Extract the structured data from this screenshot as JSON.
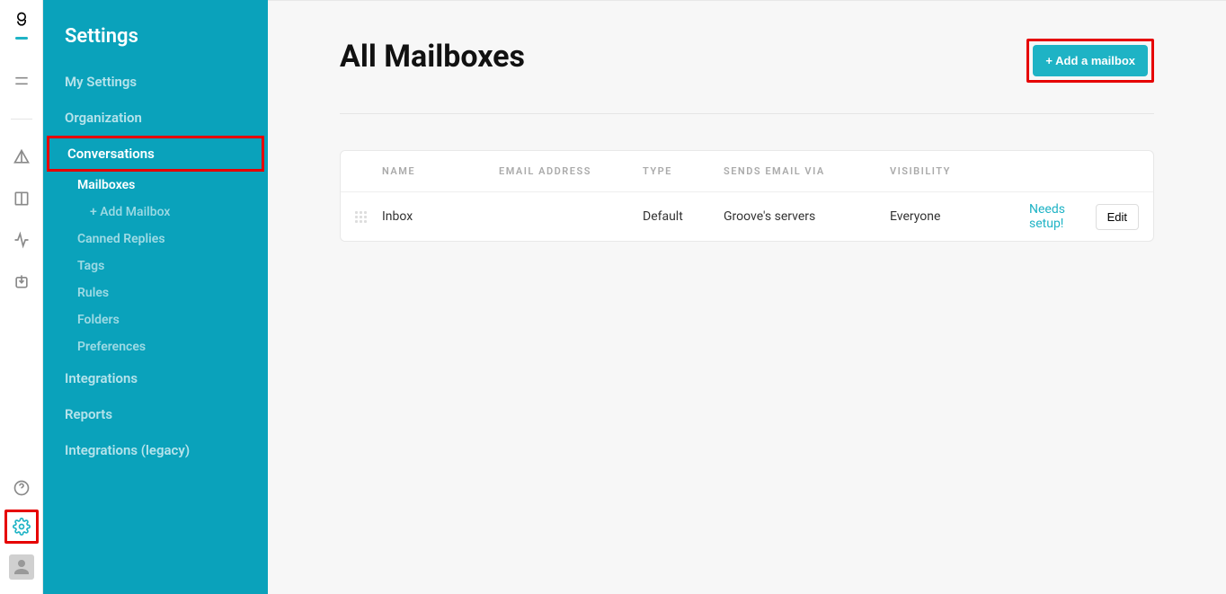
{
  "sidebar": {
    "title": "Settings",
    "items": [
      {
        "label": "My Settings"
      },
      {
        "label": "Organization"
      },
      {
        "label": "Conversations"
      },
      {
        "label": "Integrations"
      },
      {
        "label": "Reports"
      },
      {
        "label": "Integrations (legacy)"
      }
    ],
    "conversationsSub": [
      {
        "label": "Mailboxes"
      },
      {
        "label": "+ Add Mailbox"
      },
      {
        "label": "Canned Replies"
      },
      {
        "label": "Tags"
      },
      {
        "label": "Rules"
      },
      {
        "label": "Folders"
      },
      {
        "label": "Preferences"
      }
    ]
  },
  "main": {
    "title": "All Mailboxes",
    "addButton": "+ Add a mailbox",
    "table": {
      "headers": {
        "name": "NAME",
        "email": "EMAIL ADDRESS",
        "type": "TYPE",
        "sends": "SENDS EMAIL VIA",
        "visibility": "VISIBILITY"
      },
      "rows": [
        {
          "name": "Inbox",
          "email": "",
          "type": "Default",
          "sends": "Groove's servers",
          "visibility": "Everyone",
          "warning": "Needs setup!",
          "edit": "Edit"
        }
      ]
    }
  }
}
